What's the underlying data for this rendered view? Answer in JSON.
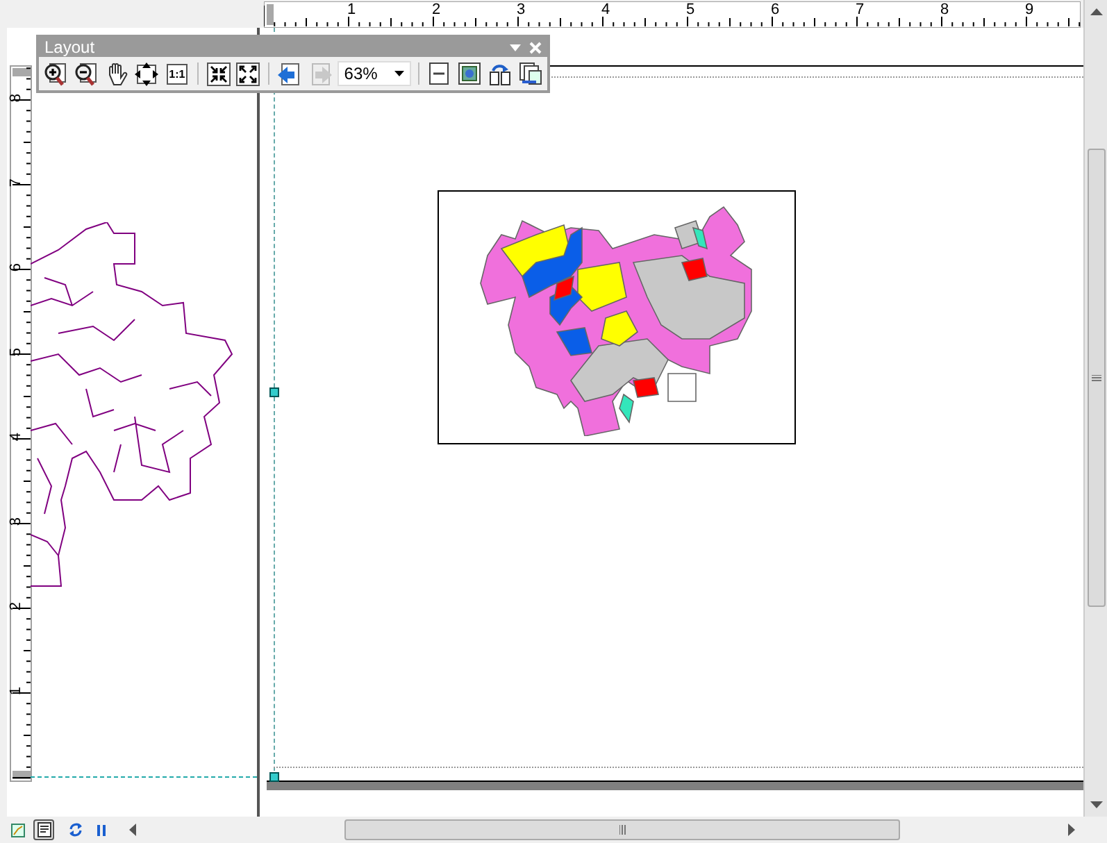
{
  "top_ruler": {
    "labels": [
      "1",
      "2",
      "3",
      "4",
      "5",
      "6",
      "7",
      "8",
      "9"
    ]
  },
  "left_ruler": {
    "labels": [
      "8",
      "7",
      "6",
      "5",
      "4",
      "3",
      "2",
      "1"
    ]
  },
  "toolbar": {
    "title": "Layout",
    "actual_size_label": "1:1",
    "history_buttons": [
      {
        "disabled": false
      },
      {
        "disabled": true
      }
    ],
    "zoom": {
      "value": "63%"
    }
  },
  "view_buttons": [
    {
      "selected": false
    },
    {
      "selected": true
    }
  ]
}
